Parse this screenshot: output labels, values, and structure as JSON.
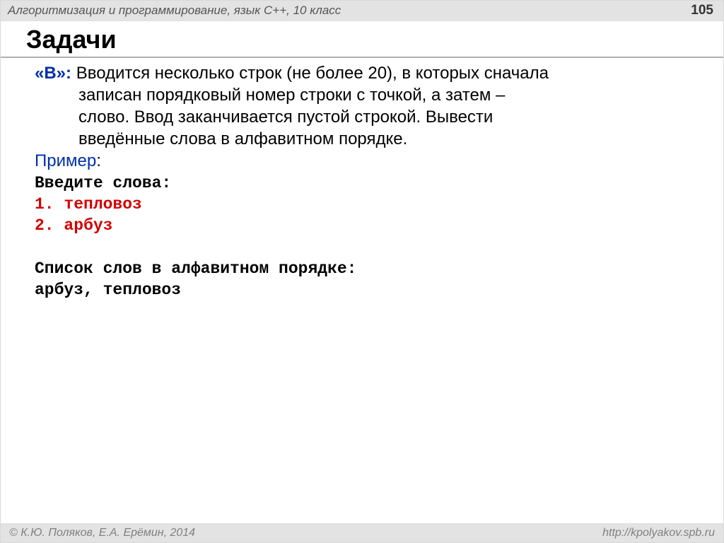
{
  "header": {
    "title": "Алгоритмизация и программирование, язык C++, 10 класс",
    "page": "105"
  },
  "title": "Задачи",
  "task": {
    "label": "«B»:",
    "line1": " Вводится несколько строк (не более 20), в которых сначала",
    "line2": "записан порядковый номер строки с точкой, а затем –",
    "line3": "слово. Ввод заканчивается пустой строкой. Вывести",
    "line4": "введённые слова в алфавитном порядке."
  },
  "example": {
    "label": "Пример",
    "colon": ":",
    "prompt": "Введите слова:",
    "input1": "1. тепловоз",
    "input2": "2. арбуз",
    "outLabel": "Список слов в алфавитном порядке:",
    "outValues": "арбуз, тепловоз"
  },
  "footer": {
    "left": "© К.Ю. Поляков, Е.А. Ерёмин, 2014",
    "right": "http://kpolyakov.spb.ru"
  }
}
